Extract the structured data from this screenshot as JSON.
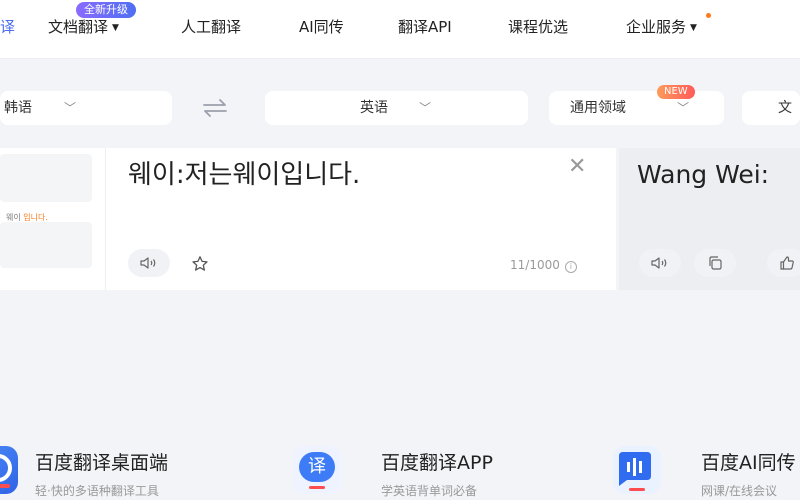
{
  "nav": {
    "partial_active": "译",
    "items": [
      {
        "label": "文档翻译",
        "badge": "全新升级",
        "has_caret": true
      },
      {
        "label": "人工翻译"
      },
      {
        "label": "AI同传"
      },
      {
        "label": "翻译API"
      },
      {
        "label": "课程优选"
      },
      {
        "label": "企业服务",
        "has_caret": true,
        "has_dot": true
      }
    ]
  },
  "language_bar": {
    "source_lang": "韩语",
    "target_lang": "英语",
    "domain": "通用领域",
    "domain_badge": "NEW",
    "extra_partial": "文"
  },
  "source": {
    "text": "웨이:저는웨이입니다.",
    "counter": "11/1000",
    "thumb_text_normal": "웨이 ",
    "thumb_text_highlight": "입니다."
  },
  "target": {
    "text": "Wang Wei:"
  },
  "apps": [
    {
      "title": "百度翻译桌面端",
      "subtitle": "轻·快的多语种翻译工具",
      "icon": "desktop-app-icon"
    },
    {
      "title": "百度翻译APP",
      "subtitle": "学英语背单词必备",
      "icon": "translate-app-icon",
      "icon_glyph": "译"
    },
    {
      "title": "百度AI同传",
      "subtitle": "网课/在线会议",
      "icon": "ai-interpretation-icon"
    }
  ],
  "colors": {
    "accent": "#4e6ef2",
    "background": "#f3f4f8",
    "new_badge": "#ff5a5a"
  }
}
